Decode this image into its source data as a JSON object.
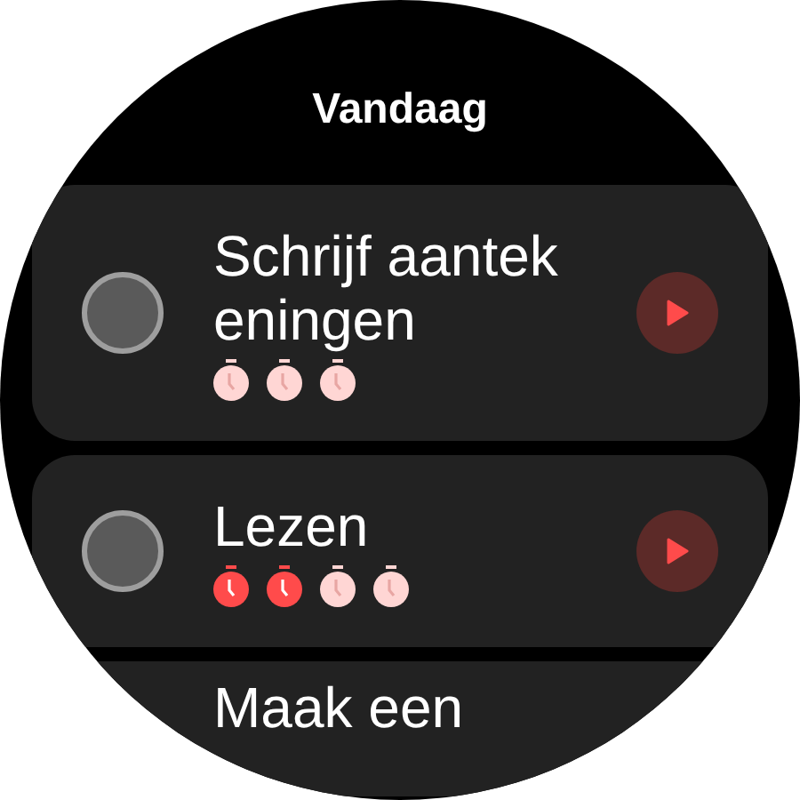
{
  "title": "Vandaag",
  "tasks": [
    {
      "name": "Schrijf aantekeningen",
      "checked": false,
      "pomodoros": [
        {
          "done": false
        },
        {
          "done": false
        },
        {
          "done": false
        }
      ]
    },
    {
      "name": "Lezen",
      "checked": false,
      "pomodoros": [
        {
          "done": true
        },
        {
          "done": true
        },
        {
          "done": false
        },
        {
          "done": false
        }
      ]
    },
    {
      "name": "Maak een"
    }
  ]
}
